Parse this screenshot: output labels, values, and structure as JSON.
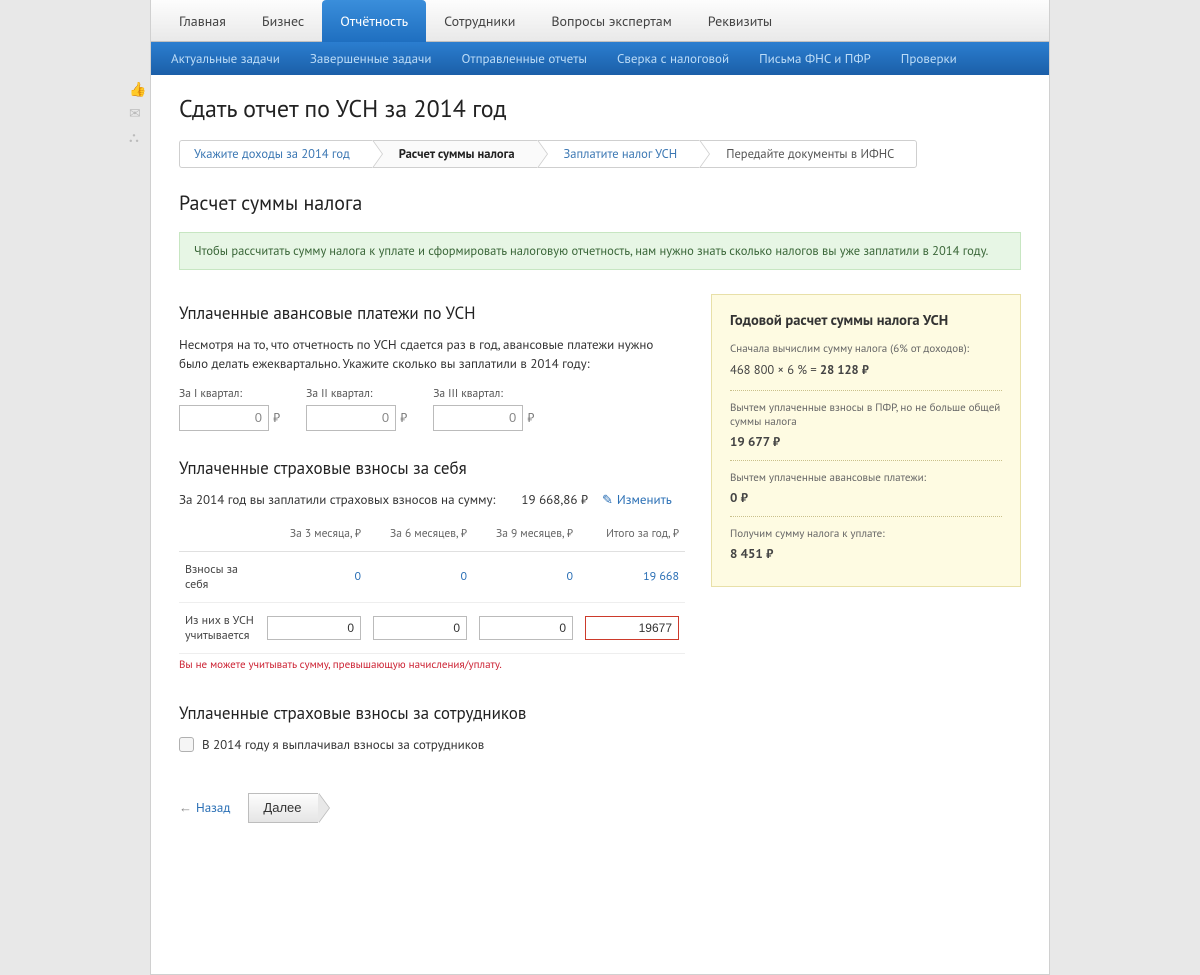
{
  "top_tabs": [
    "Главная",
    "Бизнес",
    "Отчётность",
    "Сотрудники",
    "Вопросы экспертам",
    "Реквизиты"
  ],
  "active_top_tab": 2,
  "sub_nav": [
    "Актуальные задачи",
    "Завершенные задачи",
    "Отправленные отчеты",
    "Сверка с налоговой",
    "Письма ФНС и ПФР",
    "Проверки"
  ],
  "page_title": "Сдать отчет по УСН за 2014 год",
  "wizard": {
    "steps": [
      "Укажите доходы за 2014 год",
      "Расчет суммы налога",
      "Заплатите налог УСН",
      "Передайте документы в ИФНС"
    ],
    "active": 1
  },
  "section_title": "Расчет суммы налога",
  "green_alert": "Чтобы рассчитать сумму налога к уплате и сформировать налоговую отчетность, нам нужно знать сколько налогов вы уже заплатили в 2014 году.",
  "advances": {
    "title": "Уплаченные авансовые платежи по УСН",
    "para": "Несмотря на то, что отчетность по УСН сдается раз в год, авансовые платежи нужно было делать ежеквартально. Укажите сколько вы заплатили в 2014 году:",
    "cols": [
      {
        "label": "За I квартал:",
        "value": "0"
      },
      {
        "label": "За II квартал:",
        "value": "0"
      },
      {
        "label": "За III квартал:",
        "value": "0"
      }
    ],
    "currency": "₽"
  },
  "insurance_self": {
    "title": "Уплаченные страховые взносы за себя",
    "paid_label": "За 2014 год вы заплатили страховых взносов на сумму:",
    "paid_amount": "19 668,86 ₽",
    "edit": "Изменить",
    "headers": [
      "",
      "За 3 месяца, ₽",
      "За 6 месяцев, ₽",
      "За 9 месяцев, ₽",
      "Итого за год, ₽"
    ],
    "row_self": {
      "label": "Взносы за себя",
      "vals": [
        "0",
        "0",
        "0",
        "19 668"
      ]
    },
    "row_usn": {
      "label": "Из них в УСН учитывается",
      "vals": [
        "0",
        "0",
        "0",
        "19677"
      ]
    },
    "error": "Вы не можете учитывать сумму, превышающую начисления/уплату."
  },
  "insurance_emp": {
    "title": "Уплаченные страховые взносы за сотрудников",
    "checkbox": "В 2014 году я выплачивал взносы за сотрудников"
  },
  "right": {
    "title": "Годовой расчет суммы налога УСН",
    "l1": "Сначала вычислим сумму налога (6% от доходов):",
    "formula_left": "468 800 × 6 % = ",
    "formula_bold": "28 128 ₽",
    "l2": "Вычтем уплаченные взносы в ПФР, но не больше общей суммы налога",
    "v2": "19 677 ₽",
    "l3": "Вычтем уплаченные авансовые платежи:",
    "v3": "0 ₽",
    "l4": "Получим сумму налога к уплате:",
    "v4": "8 451 ₽"
  },
  "actions": {
    "back": "Назад",
    "next": "Далее"
  }
}
